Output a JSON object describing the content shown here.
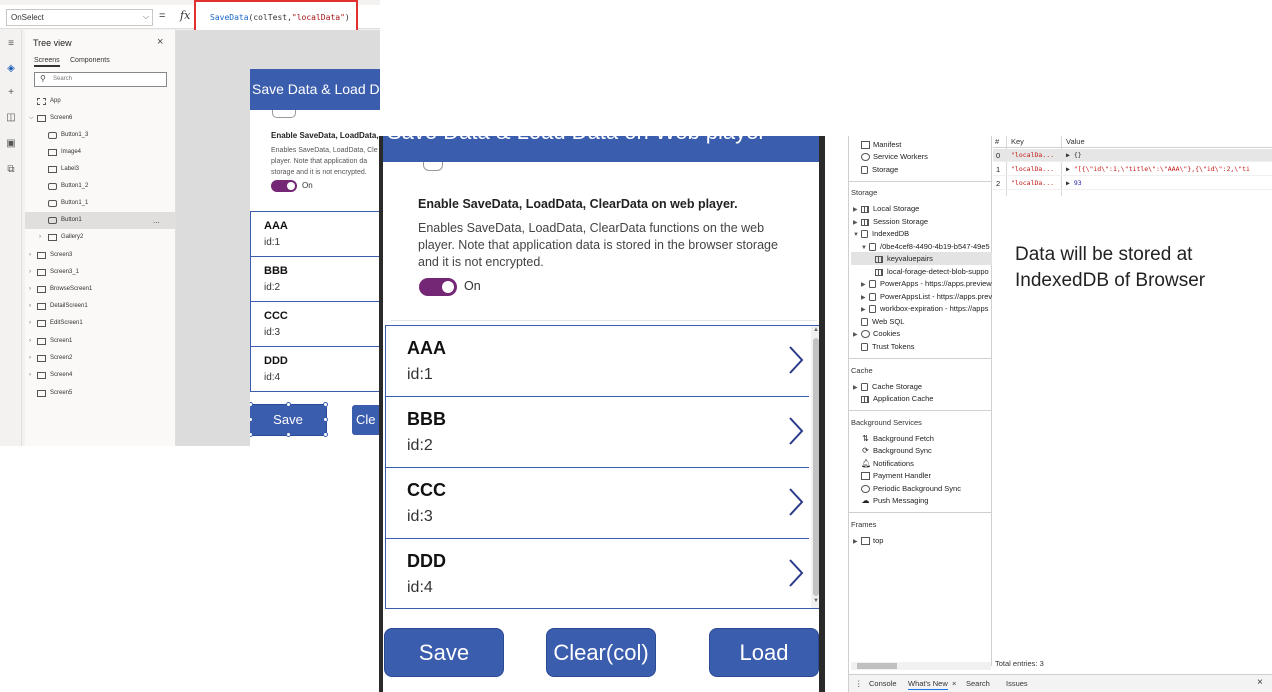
{
  "studio": {
    "property_select": "OnSelect",
    "equals": "=",
    "fx": "fx",
    "formula": {
      "fn": "SaveData",
      "open": "(",
      "arg1": "colTest",
      "comma": ",",
      "arg2": "\"localData\"",
      "close": ")"
    },
    "tree": {
      "title": "Tree view",
      "close": "×",
      "tabs": [
        "Screens",
        "Components"
      ],
      "search_placeholder": "Search",
      "items": [
        {
          "label": "App"
        },
        {
          "label": "Screen6"
        },
        {
          "label": "Button1_3"
        },
        {
          "label": "Image4"
        },
        {
          "label": "Label3"
        },
        {
          "label": "Button1_2"
        },
        {
          "label": "Button1_1"
        },
        {
          "label": "Button1",
          "more": "..."
        },
        {
          "label": "Gallery2"
        },
        {
          "label": "Screen3"
        },
        {
          "label": "Screen3_1"
        },
        {
          "label": "BrowseScreen1"
        },
        {
          "label": "DetailScreen1"
        },
        {
          "label": "EditScreen1"
        },
        {
          "label": "Screen1"
        },
        {
          "label": "Screen2"
        },
        {
          "label": "Screen4"
        },
        {
          "label": "Screen5"
        }
      ]
    },
    "canvas": {
      "header": "Save Data & Load Da",
      "toggle_title": "Enable SaveData, LoadData, Clea",
      "toggle_desc_lines": [
        "Enables SaveData, LoadData, Cle",
        "player. Note that application da",
        "storage and it is not encrypted."
      ],
      "toggle_state": "On",
      "items": [
        {
          "title": "AAA",
          "sub": "id:1"
        },
        {
          "title": "BBB",
          "sub": "id:2"
        },
        {
          "title": "CCC",
          "sub": "id:3"
        },
        {
          "title": "DDD",
          "sub": "id:4"
        }
      ],
      "save": "Save",
      "clear": "Cle"
    }
  },
  "player": {
    "header": "Save Data & Load Data on Web player",
    "toggle_title": "Enable SaveData, LoadData, ClearData on web player.",
    "toggle_desc": "Enables SaveData, LoadData, ClearData functions on the web player. Note that application data is stored in the browser storage and it is not encrypted.",
    "toggle_state": "On",
    "items": [
      {
        "title": "AAA",
        "sub": "id:1"
      },
      {
        "title": "BBB",
        "sub": "id:2"
      },
      {
        "title": "CCC",
        "sub": "id:3"
      },
      {
        "title": "DDD",
        "sub": "id:4"
      }
    ],
    "buttons": {
      "save": "Save",
      "clear": "Clear(col)",
      "load": "Load"
    }
  },
  "devtools": {
    "sidebar": {
      "application": [
        "Manifest",
        "Service Workers",
        "Storage"
      ],
      "storage_title": "Storage",
      "storage": {
        "local": "Local Storage",
        "session": "Session Storage",
        "indexeddb": "IndexedDB",
        "db": "/0be4cef8-4490-4b19-b547-49e5",
        "store_sel": "keyvaluepairs",
        "store2": "local-forage-detect-blob-suppo",
        "db2": "PowerApps - https://apps.preview",
        "db3": "PowerAppsList - https://apps.prev",
        "db4": "workbox-expiration - https://apps",
        "websql": "Web SQL",
        "cookies": "Cookies",
        "trust": "Trust Tokens"
      },
      "cache_title": "Cache",
      "cache": [
        "Cache Storage",
        "Application Cache"
      ],
      "bg_title": "Background Services",
      "bg": [
        "Background Fetch",
        "Background Sync",
        "Notifications",
        "Payment Handler",
        "Periodic Background Sync",
        "Push Messaging"
      ],
      "frames_title": "Frames",
      "frames": [
        "top"
      ]
    },
    "table": {
      "headers": {
        "num": "#",
        "key": "Key",
        "value": "Value"
      },
      "rows": [
        {
          "num": "0",
          "key": "\"localDa...",
          "value": "{}"
        },
        {
          "num": "1",
          "key": "\"localDa...",
          "value": "\"[{\\\"id\\\":1,\\\"title\\\":\\\"AAA\\\"},{\\\"id\\\":2,\\\"ti"
        },
        {
          "num": "2",
          "key": "\"localDa...",
          "value": "93"
        }
      ],
      "total": "Total entries: 3"
    },
    "bottom_tabs": {
      "console": "Console",
      "whats_new": "What's New",
      "close_x": "×",
      "search": "Search",
      "issues": "Issues",
      "close": "×",
      "menu": "⋮"
    }
  },
  "annotation": {
    "line1": "Data will be stored at",
    "line2": "IndexedDB of Browser"
  },
  "colors": {
    "brand": "#3b5dae",
    "toggle": "#742774",
    "highlight": "#e03030"
  }
}
